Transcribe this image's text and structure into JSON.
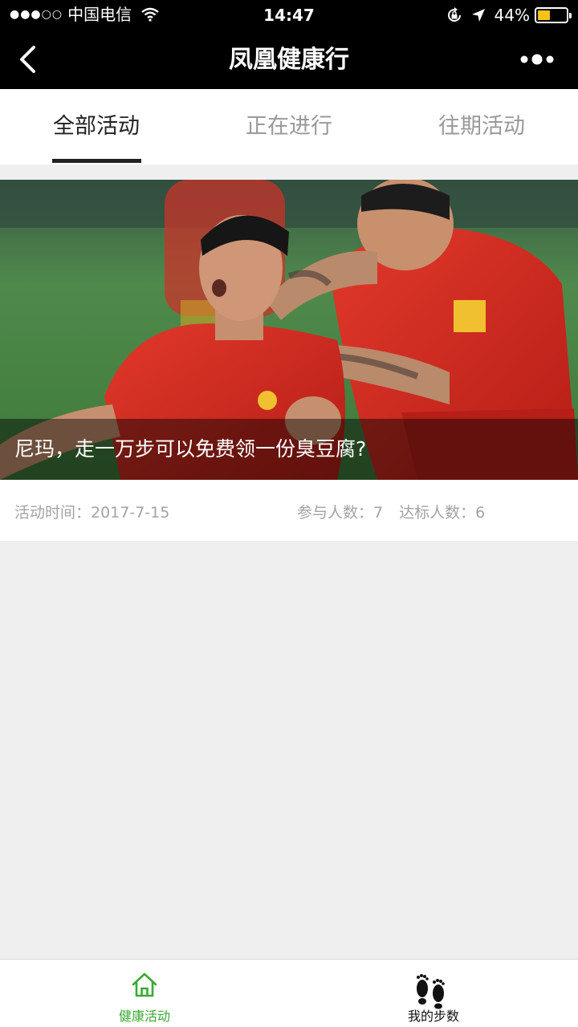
{
  "status_bar": {
    "signal_dots": "●●●○○",
    "carrier": "中国电信",
    "time": "14:47",
    "battery_percent": "44%",
    "battery_level": 0.44,
    "icons": [
      "signal-dots",
      "wifi-icon",
      "orientation-lock-icon",
      "location-arrow-icon",
      "battery-icon"
    ]
  },
  "nav": {
    "title": "凤凰健康行",
    "back_icon": "back-icon",
    "more_icon": "more-icon"
  },
  "tabs": [
    {
      "label": "全部活动",
      "active": true
    },
    {
      "label": "正在进行",
      "active": false
    },
    {
      "label": "往期活动",
      "active": false
    }
  ],
  "activity": {
    "image": "footballers-celebrating-photo",
    "title": "尼玛，走一万步可以免费领一份臭豆腐?",
    "date_label": "活动时间：2017-7-15",
    "participants_label": "参与人数：7",
    "achieved_label": "达标人数：6"
  },
  "tabbar": [
    {
      "label": "健康活动",
      "icon": "home-icon",
      "active": true
    },
    {
      "label": "我的步数",
      "icon": "footprints-icon",
      "active": false
    }
  ],
  "colors": {
    "accent_green": "#3aa932",
    "header_bg": "#000000",
    "page_bg": "#efefef"
  }
}
